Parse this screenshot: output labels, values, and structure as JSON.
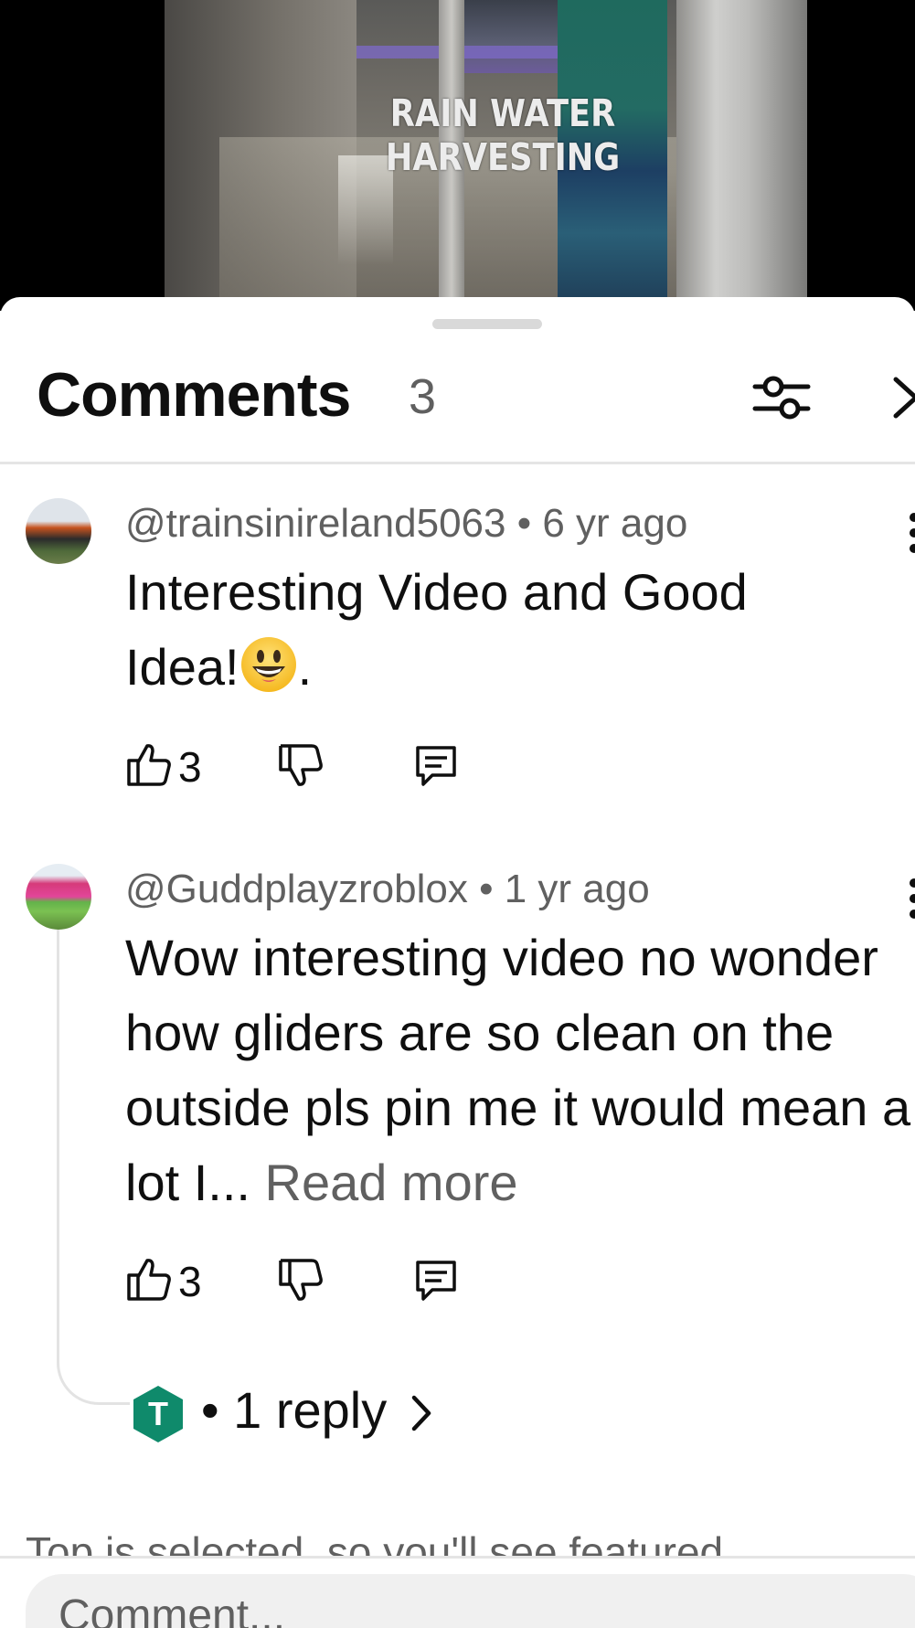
{
  "video": {
    "caption": "RAIN WATER HARVESTING"
  },
  "sheet": {
    "title": "Comments",
    "count": "3",
    "icons": [
      "filter-icon",
      "chevron-right-icon"
    ]
  },
  "comments": [
    {
      "author": "@trainsinireland5063",
      "time": "6 yr ago",
      "separator": "•",
      "text": "Interesting Video and Good Idea!",
      "text_suffix": ".",
      "emoji": "grinning-face-emoji",
      "likes": "3"
    },
    {
      "author": "@Guddplayzroblox",
      "time": "1 yr ago",
      "separator": "•",
      "text": "Wow interesting video no wonder how gliders are so clean on the outside pls pin me it would mean a lot I...",
      "read_more": "Read more",
      "likes": "3",
      "replies": {
        "avatar_letter": "T",
        "avatar_color": "#0f8a6b",
        "label": "• 1 reply"
      }
    }
  ],
  "footer": {
    "note": "Top is selected, so you'll see featured",
    "input_placeholder": "Comment..."
  },
  "colors": {
    "text_primary": "#0f0f0f",
    "text_secondary": "#606060",
    "divider": "#e5e5e5"
  }
}
